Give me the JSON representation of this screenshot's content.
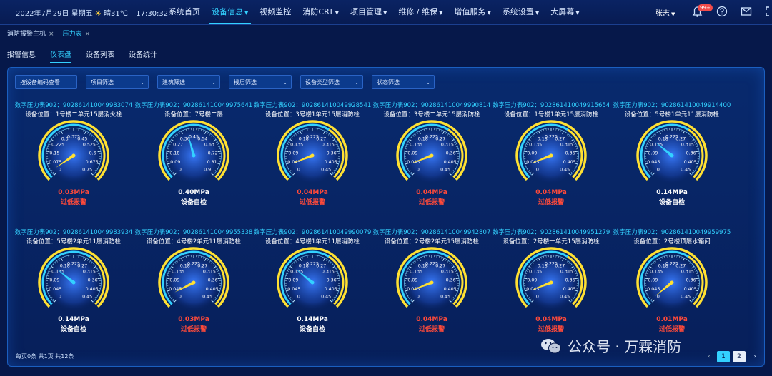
{
  "header": {
    "datetime": "2022年7月29日 星期五",
    "weather": "晴31℃",
    "time": "17:30:32",
    "nav": [
      {
        "label": "系统首页",
        "caret": false
      },
      {
        "label": "设备信息",
        "caret": true,
        "active": true
      },
      {
        "label": "视频监控",
        "caret": false
      },
      {
        "label": "消防CRT",
        "caret": true
      },
      {
        "label": "项目管理",
        "caret": true
      },
      {
        "label": "维修 / 维保",
        "caret": true
      },
      {
        "label": "增值服务",
        "caret": true
      },
      {
        "label": "系统设置",
        "caret": true
      },
      {
        "label": "大屏幕",
        "caret": true
      }
    ],
    "user": "张志",
    "notify_badge": "99+",
    "icons": [
      "bell-icon",
      "help-icon",
      "mail-icon",
      "fullscreen-icon"
    ]
  },
  "tabs": [
    {
      "label": "消防报警主机",
      "active": false
    },
    {
      "label": "压力表",
      "active": true
    }
  ],
  "subtabs": [
    {
      "label": "报警信息",
      "active": false
    },
    {
      "label": "仪表盘",
      "active": true
    },
    {
      "label": "设备列表",
      "active": false
    },
    {
      "label": "设备统计",
      "active": false
    }
  ],
  "filters": {
    "code_input": "按设备编码查看",
    "project": "项目筛选",
    "building": "建筑筛选",
    "floor": "楼层筛选",
    "device_type": "设备类型筛选",
    "status": "状态筛选"
  },
  "gauges": [
    {
      "title": "数字压力表902：902861410049983074",
      "location": "设备位置：1号楼二单元15层消火栓",
      "max": 0.75,
      "ticks": [
        "0",
        "0.075",
        "0.15",
        "0.225",
        "0.3",
        "0.375",
        "0.45",
        "0.525",
        "0.6",
        "0.675",
        "0.75"
      ],
      "value": 0.03,
      "value_text": "0.03MPa",
      "status": "过低报警",
      "status_color": "red"
    },
    {
      "title": "数字压力表902：902861410049975641",
      "location": "设备位置：7号楼二层",
      "max": 0.9,
      "ticks": [
        "0",
        "0.09",
        "0.18",
        "0.27",
        "0.36",
        "0.45",
        "0.54",
        "0.63",
        "0.72",
        "0.81",
        "0.9"
      ],
      "value": 0.4,
      "value_text": "0.40MPa",
      "status": "设备自检",
      "status_color": "white"
    },
    {
      "title": "数字压力表902：902861410049928541",
      "location": "设备位置：3号楼1单元15层消防栓",
      "max": 0.45,
      "ticks": [
        "0",
        "0.045",
        "0.09",
        "0.135",
        "0.18",
        "0.225",
        "0.27",
        "0.315",
        "0.36",
        "0.405",
        "0.45"
      ],
      "value": 0.04,
      "value_text": "0.04MPa",
      "status": "过低报警",
      "status_color": "red"
    },
    {
      "title": "数字压力表902：902861410049990814",
      "location": "设备位置：3号楼二单元15层消防栓",
      "max": 0.45,
      "ticks": [
        "0",
        "0.045",
        "0.09",
        "0.135",
        "0.18",
        "0.225",
        "0.27",
        "0.315",
        "0.36",
        "0.405",
        "0.45"
      ],
      "value": 0.04,
      "value_text": "0.04MPa",
      "status": "过低报警",
      "status_color": "red"
    },
    {
      "title": "数字压力表902：902861410049915654",
      "location": "设备位置：1号楼1单元15层消防栓",
      "max": 0.45,
      "ticks": [
        "0",
        "0.045",
        "0.09",
        "0.135",
        "0.18",
        "0.225",
        "0.27",
        "0.315",
        "0.36",
        "0.405",
        "0.45"
      ],
      "value": 0.04,
      "value_text": "0.04MPa",
      "status": "过低报警",
      "status_color": "red"
    },
    {
      "title": "数字压力表902：902861410049914400",
      "location": "设备位置：5号楼1单元11层消防栓",
      "max": 0.45,
      "ticks": [
        "0",
        "0.045",
        "0.09",
        "0.135",
        "0.18",
        "0.225",
        "0.27",
        "0.315",
        "0.36",
        "0.405",
        "0.45"
      ],
      "value": 0.14,
      "value_text": "0.14MPa",
      "status": "设备自检",
      "status_color": "white"
    },
    {
      "title": "数字压力表902：902861410049983934",
      "location": "设备位置：5号楼2单元11层消防栓",
      "max": 0.45,
      "ticks": [
        "0",
        "0.045",
        "0.09",
        "0.135",
        "0.18",
        "0.225",
        "0.27",
        "0.315",
        "0.36",
        "0.405",
        "0.45"
      ],
      "value": 0.14,
      "value_text": "0.14MPa",
      "status": "设备自检",
      "status_color": "white"
    },
    {
      "title": "数字压力表902：902861410049955338",
      "location": "设备位置：4号楼2单元11层消防栓",
      "max": 0.45,
      "ticks": [
        "0",
        "0.045",
        "0.09",
        "0.135",
        "0.18",
        "0.225",
        "0.27",
        "0.315",
        "0.36",
        "0.405",
        "0.45"
      ],
      "value": 0.03,
      "value_text": "0.03MPa",
      "status": "过低报警",
      "status_color": "red"
    },
    {
      "title": "数字压力表902：902861410049990079",
      "location": "设备位置：4号楼1单元11层消防栓",
      "max": 0.45,
      "ticks": [
        "0",
        "0.045",
        "0.09",
        "0.135",
        "0.18",
        "0.225",
        "0.27",
        "0.315",
        "0.36",
        "0.405",
        "0.45"
      ],
      "value": 0.14,
      "value_text": "0.14MPa",
      "status": "设备自检",
      "status_color": "white"
    },
    {
      "title": "数字压力表902：902861410049942807",
      "location": "设备位置：2号楼2单元15层消防栓",
      "max": 0.45,
      "ticks": [
        "0",
        "0.045",
        "0.09",
        "0.135",
        "0.18",
        "0.225",
        "0.27",
        "0.315",
        "0.36",
        "0.405",
        "0.45"
      ],
      "value": 0.04,
      "value_text": "0.04MPa",
      "status": "过低报警",
      "status_color": "red"
    },
    {
      "title": "数字压力表902：902861410049951279",
      "location": "设备位置：2号楼一单元15层消防栓",
      "max": 0.45,
      "ticks": [
        "0",
        "0.045",
        "0.09",
        "0.135",
        "0.18",
        "0.225",
        "0.27",
        "0.315",
        "0.36",
        "0.405",
        "0.45"
      ],
      "value": 0.04,
      "value_text": "0.04MPa",
      "status": "过低报警",
      "status_color": "red"
    },
    {
      "title": "数字压力表902：902861410049959975",
      "location": "设备位置：2号楼顶层水箱间",
      "max": 0.45,
      "ticks": [
        "0",
        "0.045",
        "0.09",
        "0.135",
        "0.18",
        "0.225",
        "0.27",
        "0.315",
        "0.36",
        "0.405",
        "0.45"
      ],
      "value": 0.01,
      "value_text": "0.01MPa",
      "status": "过低报警",
      "status_color": "red"
    }
  ],
  "pagination": {
    "summary": "每页0条  共1页  共12条",
    "pages": [
      "1",
      "2"
    ],
    "current": "1"
  },
  "watermark": "公众号 · 万霖消防",
  "colors": {
    "accent": "#33d1ff",
    "alarm": "#ff4a3a",
    "gauge_rim": "#ffe032",
    "panel_bg": "#071f5a"
  }
}
